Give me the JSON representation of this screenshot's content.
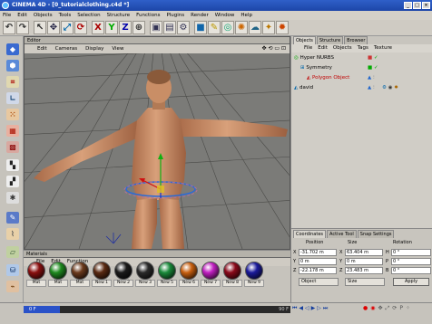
{
  "window": {
    "title": "CINEMA 4D - [0_tutorialclothing.c4d *]"
  },
  "window_controls": {
    "minimize": "_",
    "maximize": "□",
    "close": "×"
  },
  "menu": [
    "File",
    "Edit",
    "Objects",
    "Tools",
    "Selection",
    "Structure",
    "Functions",
    "Plugins",
    "Render",
    "Window",
    "Help"
  ],
  "viewport": {
    "title": "Editor",
    "menu": [
      "Edit",
      "Cameras",
      "Display",
      "View"
    ],
    "nav": "✥ ⟲ ▭ ⊡"
  },
  "object_manager": {
    "tabs": [
      "Objects",
      "Structure",
      "Browser"
    ],
    "menu": [
      "File",
      "Edit",
      "Objects",
      "Tags",
      "Texture"
    ],
    "objects": [
      {
        "name": "Hyper NURBS",
        "indent": 0
      },
      {
        "name": "Symmetry",
        "indent": 1
      },
      {
        "name": "Polygon Object",
        "indent": 2,
        "highlight": true
      },
      {
        "name": "david",
        "indent": 0
      }
    ]
  },
  "coordinates": {
    "tabs": [
      "Coordinates",
      "Active Tool",
      "Snap Settings"
    ],
    "headers": {
      "position": "Position",
      "size": "Size",
      "rotation": "Rotation"
    },
    "rows": [
      {
        "axis": "X",
        "position": "-31.702 m",
        "size_axis": "X",
        "size": "63.404 m",
        "rot_axis": "H",
        "rotation": "0 °"
      },
      {
        "axis": "Y",
        "position": "0 m",
        "size_axis": "Y",
        "size": "0 m",
        "rot_axis": "P",
        "rotation": "0 °"
      },
      {
        "axis": "Z",
        "position": "-22.178 m",
        "size_axis": "Z",
        "size": "23.483 m",
        "rot_axis": "B",
        "rotation": "0 °"
      }
    ],
    "mode_select": "Object",
    "size_select": "Size",
    "apply_label": "Apply"
  },
  "materials": {
    "title": "Materials",
    "menu": [
      "File",
      "Edit",
      "Function"
    ],
    "items": [
      {
        "label": "Mat",
        "color": "#8a1010"
      },
      {
        "label": "Mat",
        "color": "#1f8a1f"
      },
      {
        "label": "Mat",
        "color": "#6b3a1c"
      },
      {
        "label": "New 1",
        "color": "#5a2a12"
      },
      {
        "label": "New 2",
        "color": "#1a1a1a"
      },
      {
        "label": "New 3",
        "color": "#2a2a2a"
      },
      {
        "label": "New 5",
        "color": "#1a8a3a"
      },
      {
        "label": "New 6",
        "color": "#c86010"
      },
      {
        "label": "New 7",
        "color": "#c020c0"
      },
      {
        "label": "New 8",
        "color": "#8a0a1a"
      },
      {
        "label": "New 9",
        "color": "#1a1a9a"
      }
    ]
  },
  "timeline": {
    "frame": "0 F",
    "end_frame": "90 F"
  },
  "colors": {
    "title_bar": "#2f5fc8",
    "viewport_bg": "#7b7b78",
    "skin": "#c9906a",
    "highlight_text": "#c00000"
  }
}
